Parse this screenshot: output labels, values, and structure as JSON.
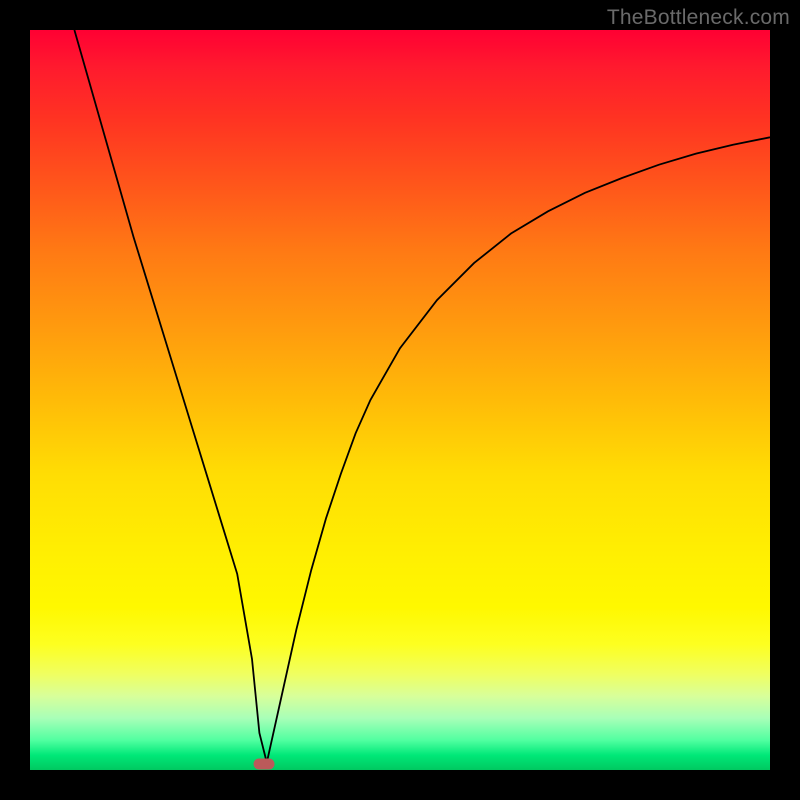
{
  "watermark": {
    "text": "TheBottleneck.com"
  },
  "chart_data": {
    "type": "line",
    "title": "",
    "xlabel": "",
    "ylabel": "",
    "xlim": [
      0,
      100
    ],
    "ylim": [
      0,
      100
    ],
    "grid": false,
    "legend": false,
    "background_gradient": {
      "top_color": "#ff0033",
      "mid_color": "#ffee00",
      "bottom_color": "#00c860"
    },
    "series": [
      {
        "name": "bottleneck-curve",
        "color": "#000000",
        "x": [
          6,
          8,
          10,
          12,
          14,
          16,
          18,
          20,
          22,
          24,
          26,
          28,
          30,
          31,
          32,
          34,
          36,
          38,
          40,
          42,
          44,
          46,
          50,
          55,
          60,
          65,
          70,
          75,
          80,
          85,
          90,
          95,
          100
        ],
        "values": [
          100,
          93,
          86,
          79,
          72,
          65.5,
          59,
          52.5,
          46,
          39.5,
          33,
          26.5,
          15,
          5,
          1,
          10,
          19,
          27,
          34,
          40,
          45.5,
          50,
          57,
          63.5,
          68.5,
          72.5,
          75.5,
          78,
          80,
          81.8,
          83.3,
          84.5,
          85.5
        ]
      }
    ],
    "marker": {
      "name": "optimal-point",
      "x": 31.5,
      "y": 0.5,
      "color": "#bb5a5a",
      "shape": "rounded-rect"
    }
  }
}
